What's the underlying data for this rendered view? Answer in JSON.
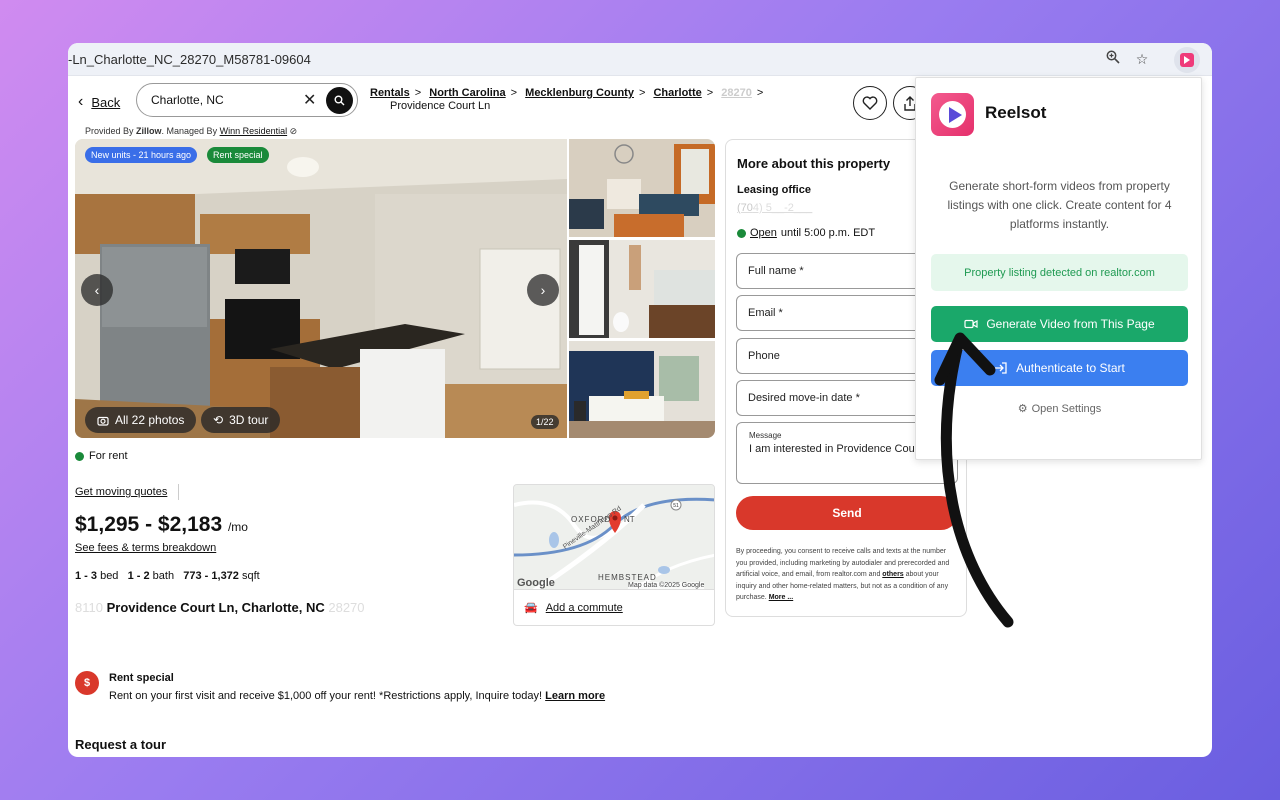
{
  "browser": {
    "url": "-Ln_Charlotte_NC_28270_M58781-09604",
    "zoom_icon": "zoom-icon",
    "star_icon": "star-icon",
    "extension_icon": "reelsot-extension-icon"
  },
  "header": {
    "back_label": "Back",
    "search_value": "Charlotte, NC",
    "breadcrumbs": [
      "Rentals",
      "North Carolina",
      "Mecklenburg County",
      "Charlotte",
      "28270"
    ],
    "breadcrumb_tail": "Providence Court Ln",
    "sep": ">"
  },
  "provided": {
    "prefix": "Provided By ",
    "provider": "Zillow",
    "managed": ". Managed By ",
    "manager": "Winn Residential"
  },
  "gallery": {
    "tag_new": "New units - 21 hours ago",
    "tag_special": "Rent special",
    "all_photos": "All 22 photos",
    "tour": "3D tour",
    "counter": "1/22"
  },
  "listing": {
    "status": "For rent",
    "moving_quotes": "Get moving quotes",
    "price": "$1,295 - $2,183",
    "per": "/mo",
    "fees": "See fees & terms breakdown",
    "beds": "1 - 3",
    "beds_label": " bed",
    "baths": "1 - 2",
    "baths_label": " bath",
    "sqft": "773 - 1,372",
    "sqft_label": " sqft",
    "address_prefix": "8110",
    "address": "Providence Court Ln, Charlotte, NC",
    "address_zip": "28270"
  },
  "map": {
    "label_oxford": "OXFORD",
    "label_hunt": "NT",
    "label_hembstead": "HEMBSTEAD",
    "road": "Pineville-Matthews Rd",
    "shield": "51",
    "google": "Google",
    "credit": "Map data ©2025 Google",
    "commute": "Add a commute"
  },
  "rent_special": {
    "icon": "$",
    "title": "Rent special",
    "text": "Rent on your first visit and receive $1,000 off your rent! *Restrictions apply, Inquire today! ",
    "learn": "Learn more"
  },
  "request_tour": "Request a tour",
  "form": {
    "title": "More about this property",
    "office": "Leasing office",
    "phone_visible": "(70",
    "phone_faded": "4) 5__-2___",
    "open": "Open",
    "hours": " until 5:00 p.m. EDT",
    "full_name": "Full name *",
    "email": "Email *",
    "phone": "Phone",
    "move_in": "Desired move-in date *",
    "message_label": "Message",
    "message_value": "I am interested in Providence Court.",
    "send": "Send",
    "legal_1": "By proceeding, you consent to receive calls and texts at the number you provided, including marketing by autodialer and prerecorded and artificial voice, and email, from realtor.com and ",
    "legal_others": "others",
    "legal_2": " about your inquiry and other home-related matters, but not as a condition of any purchase. ",
    "legal_more": "More ..."
  },
  "extension": {
    "name": "Reelsot",
    "description": "Generate short-form videos from property listings with one click. Create content for 4 platforms instantly.",
    "detected": "Property listing detected on realtor.com",
    "generate": "Generate Video from This Page",
    "authenticate": "Authenticate to Start",
    "settings": "Open Settings"
  },
  "colors": {
    "send_red": "#d9382b",
    "generate_green": "#1aa86a",
    "auth_blue": "#3b7ff0",
    "detected_bg": "#e5f7ec",
    "brand_pink": "#ef3b7a"
  }
}
